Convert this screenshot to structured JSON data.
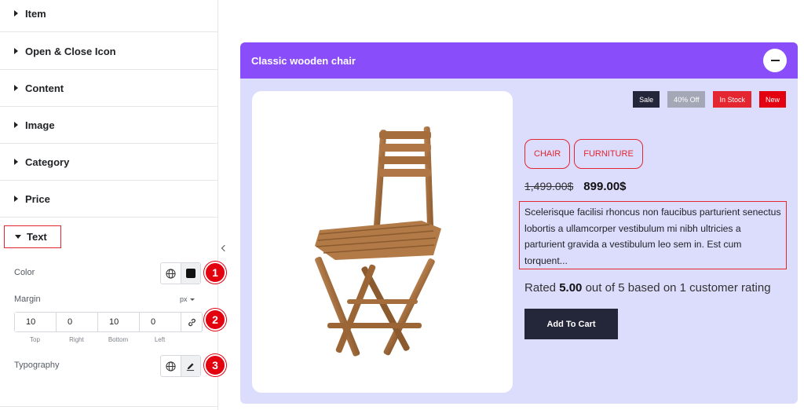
{
  "panel": {
    "sections": [
      {
        "label": "Item"
      },
      {
        "label": "Open & Close Icon"
      },
      {
        "label": "Content"
      },
      {
        "label": "Image"
      },
      {
        "label": "Category"
      },
      {
        "label": "Price"
      }
    ],
    "text_section": {
      "label": "Text"
    },
    "color": {
      "label": "Color",
      "value": "#111111"
    },
    "margin": {
      "label": "Margin",
      "unit": "px",
      "values": {
        "top": "10",
        "right": "0",
        "bottom": "10",
        "left": "0"
      },
      "sublabels": {
        "top": "Top",
        "right": "Right",
        "bottom": "Bottom",
        "left": "Left"
      }
    },
    "typography": {
      "label": "Typography"
    },
    "steps": [
      "1",
      "2",
      "3"
    ]
  },
  "product": {
    "title": "Classic wooden chair",
    "badges": [
      {
        "label": "Sale",
        "color": "#242639"
      },
      {
        "label": "40% Off",
        "color": "#a4a7b5"
      },
      {
        "label": "In Stock",
        "color": "#e3262f"
      },
      {
        "label": "New",
        "color": "#e3000f"
      }
    ],
    "tags": [
      "CHAIR",
      "FURNITURE"
    ],
    "old_price": "1,499.00$",
    "new_price": "899.00$",
    "description": "Scelerisque facilisi rhoncus non faucibus parturient senectus lobortis a ullamcorper vestibulum mi nibh ultricies a parturient gravida a vestibulum leo sem in. Est cum torquent...",
    "rating": {
      "prefix": "Rated",
      "score": "5.00",
      "suffix": "out of 5 based on 1 customer rating"
    },
    "cart_label": "Add To Cart"
  },
  "colors": {
    "header_purple": "#8a4dfa",
    "card_lavender": "#dcdcfd",
    "accent_red": "#e3262f",
    "dark_button": "#242639"
  }
}
